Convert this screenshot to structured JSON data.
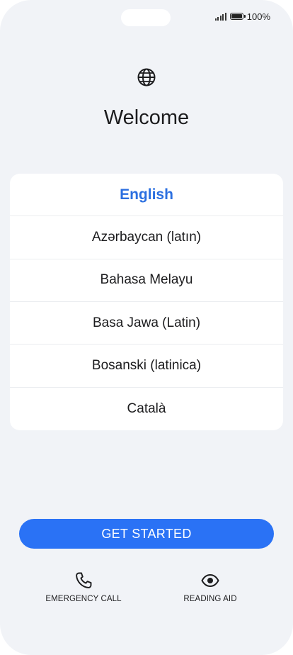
{
  "status_bar": {
    "battery_text": "100%"
  },
  "header": {
    "icon": "globe-icon",
    "title": "Welcome"
  },
  "languages": {
    "selected_index": 0,
    "items": [
      {
        "label": "English"
      },
      {
        "label": "Azərbaycan (latın)"
      },
      {
        "label": "Bahasa Melayu"
      },
      {
        "label": "Basa Jawa (Latin)"
      },
      {
        "label": "Bosanski (latinica)"
      },
      {
        "label": "Català"
      }
    ]
  },
  "actions": {
    "primary_label": "GET STARTED",
    "emergency_label": "EMERGENCY CALL",
    "emergency_icon": "phone-icon",
    "reading_label": "READING AID",
    "reading_icon": "eye-icon"
  },
  "colors": {
    "accent": "#2a72f5",
    "selected_text": "#2b6fe0",
    "background": "#f1f3f7",
    "card": "#ffffff"
  }
}
